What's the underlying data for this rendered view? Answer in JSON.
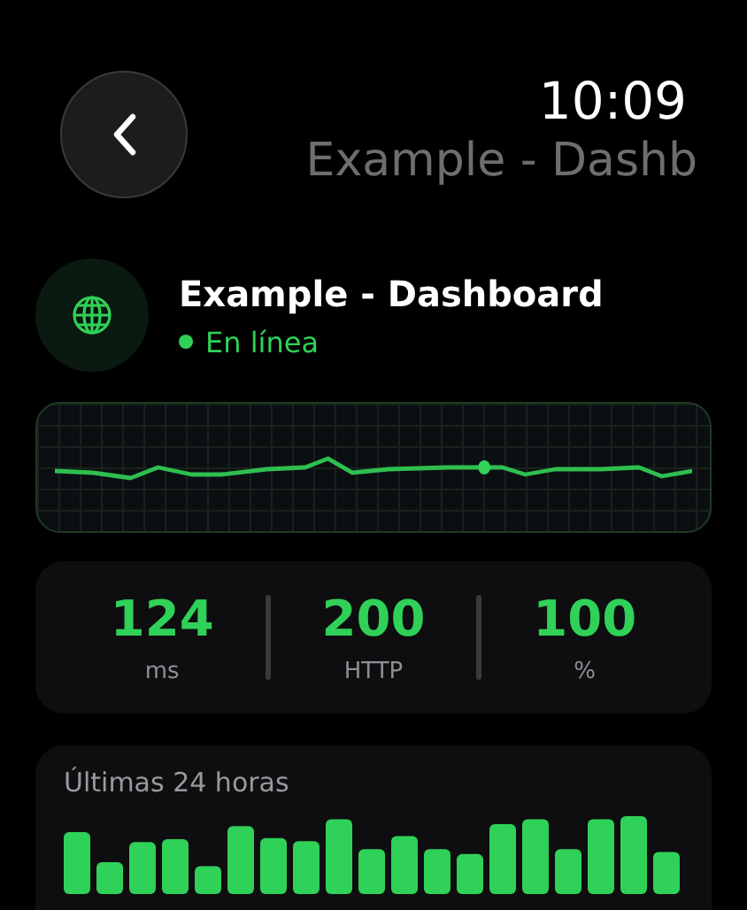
{
  "clock": "10:09",
  "nav_title": "Example - Dashb",
  "site": {
    "name": "Example - Dashboard",
    "status": "En línea",
    "online": true
  },
  "stats": [
    {
      "value": "124",
      "unit": "ms"
    },
    {
      "value": "200",
      "unit": "HTTP"
    },
    {
      "value": "100",
      "unit": "%"
    }
  ],
  "history": {
    "title": "Últimas 24 horas"
  }
}
